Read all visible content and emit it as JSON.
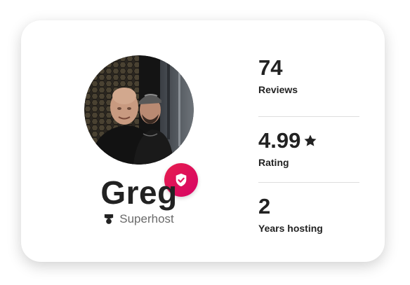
{
  "host": {
    "name": "Greg",
    "badge_label": "Superhost",
    "verified_icon": "shield-check-icon",
    "superhost_icon": "superhost-medal-icon"
  },
  "stats": [
    {
      "value": "74",
      "label": "Reviews"
    },
    {
      "value": "4.99",
      "label": "Rating",
      "icon": "star-icon"
    },
    {
      "value": "2",
      "label": "Years hosting"
    }
  ],
  "colors": {
    "badge": "#e31c5f",
    "text": "#222222",
    "muted": "#6a6a6a",
    "divider": "#dddddd"
  }
}
